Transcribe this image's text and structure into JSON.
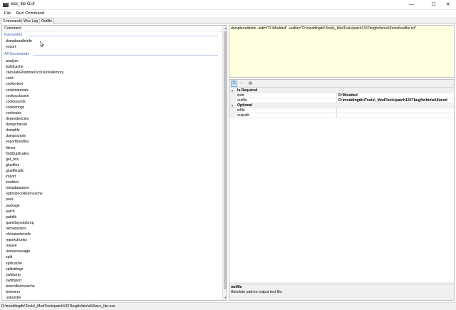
{
  "window": {
    "title": "wcc_lite GUI",
    "icon": "app-icon",
    "controls": {
      "minimize": "—",
      "maximize": "☐",
      "close": "✕"
    }
  },
  "menubar": {
    "items": [
      "File",
      "Run Command"
    ]
  },
  "tabs": [
    "Commands",
    "Wcc Log",
    "Outfile"
  ],
  "left_panel": {
    "column_header": "Command",
    "favourites_label": "Favourites",
    "favourites": [
      "dumpbundleinfo",
      "export"
    ],
    "all_label": "All Commands",
    "commands": [
      "analyze",
      "buildcache",
      "calculateRuntimeOcclusionMemory",
      "cook",
      "cookertest",
      "cookmaterials",
      "cookocclusion",
      "cooksounds",
      "cookstrings",
      "cooksubs",
      "dependencies",
      "dumpcharset",
      "dumpfile",
      "dumpscripts",
      "exportbundles",
      "filever",
      "findDuplicates",
      "get_txts",
      "gluefiles",
      "gluefilesdlc",
      "import",
      "loadtest",
      "metadatastore",
      "optimizecollisioncache",
      "pack",
      "package",
      "patch",
      "pathlib",
      "questlayoutdump",
      "r4characters",
      "r4charactersdlc",
      "reportchunks",
      "resave",
      "resourceusage",
      "split",
      "splitcache",
      "splitstrings",
      "swfdump",
      "swfimport",
      "testcollisioncache",
      "textmem",
      "unbundle"
    ]
  },
  "command_line": "dumpbundleinfo -indir=\"D:\\Modded\" -outfile=\"D:\\moddingdir\\Tools\\_ModTools\\patch1337bugfix\\bin\\x64\\mod\\outfile.txt\"",
  "property_grid": {
    "toolbar_icons": [
      "categorized-icon",
      "alphabetical-icon",
      "property-pages-icon"
    ],
    "categories": [
      {
        "name": "Is Required",
        "props": [
          {
            "name": "indir",
            "value": "D:\\Modded"
          },
          {
            "name": "outfile",
            "value": "D:\\moddingdir\\Tools\\_ModTools\\patch1337bugfix\\bin\\x64\\mod"
          }
        ]
      },
      {
        "name": "Optional",
        "props": [
          {
            "name": "infile",
            "value": ""
          },
          {
            "name": "outpath",
            "value": ""
          }
        ]
      }
    ],
    "help_title": "outfile",
    "help_desc": "Absolute path to output text file."
  },
  "statusbar": {
    "text": "D:\\moddingdir\\Tools\\_ModTools\\patch1337bugfix\\bin\\x64\\wcc_lite.exe"
  },
  "colors": {
    "group_header": "#3c5fa8",
    "command_bg": "#ffffe1",
    "selected_toolbar": "#cce4f7"
  }
}
